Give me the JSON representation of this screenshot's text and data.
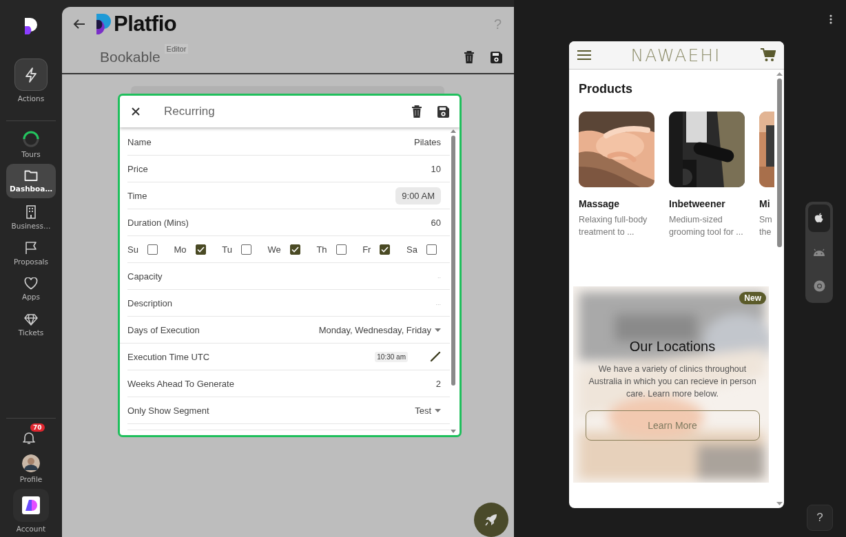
{
  "sidebar": {
    "actions": {
      "label": "Actions"
    },
    "items": [
      {
        "label": "Tours",
        "selected": false
      },
      {
        "label": "Dashboa…",
        "selected": true
      },
      {
        "label": "Business…",
        "selected": false
      },
      {
        "label": "Proposals",
        "selected": false
      },
      {
        "label": "Apps",
        "selected": false
      },
      {
        "label": "Tickets",
        "selected": false
      }
    ],
    "notifications": {
      "badge": "70"
    },
    "profile": {
      "label": "Profile"
    },
    "account": {
      "label": "Account"
    }
  },
  "header": {
    "logo_text": "Platfio",
    "help": "?",
    "title": "Bookable",
    "tag": "Editor"
  },
  "modal": {
    "title": "Recurring",
    "rows": [
      {
        "kind": "text",
        "label": "Name",
        "value": "Pilates"
      },
      {
        "kind": "text",
        "label": "Price",
        "value": "10"
      },
      {
        "kind": "chip",
        "label": "Time",
        "value": "9:00 AM"
      },
      {
        "kind": "text",
        "label": "Duration (Mins)",
        "value": "60"
      },
      {
        "kind": "days",
        "days": [
          {
            "label": "Su",
            "checked": false
          },
          {
            "label": "Mo",
            "checked": true
          },
          {
            "label": "Tu",
            "checked": false
          },
          {
            "label": "We",
            "checked": true
          },
          {
            "label": "Th",
            "checked": false
          },
          {
            "label": "Fr",
            "checked": true
          },
          {
            "label": "Sa",
            "checked": false
          }
        ]
      },
      {
        "kind": "hint",
        "label": "Capacity",
        "placeholder": ".."
      },
      {
        "kind": "hint",
        "label": "Description",
        "placeholder": "..."
      },
      {
        "kind": "select",
        "label": "Days of Execution",
        "value": "Monday, Wednesday, Friday"
      },
      {
        "kind": "edit",
        "label": "Execution Time UTC",
        "value": "10:30 am"
      },
      {
        "kind": "text",
        "label": "Weeks Ahead To Generate",
        "value": "2"
      },
      {
        "kind": "select",
        "label": "Only Show Segment",
        "value": "Test"
      }
    ]
  },
  "preview": {
    "brand": "NAWAEHI",
    "products_title": "Products",
    "products": [
      {
        "kind": "full",
        "name": "Massage",
        "description": "Relaxing full-body treatment to ..."
      },
      {
        "kind": "full",
        "name": "Inbetweener",
        "description": "Medium-sized grooming tool for ..."
      },
      {
        "kind": "partial",
        "name": "Mi",
        "description": "Sm the"
      }
    ],
    "promo": {
      "badge": "New",
      "title": "Our Locations",
      "text": "We have a variety of clinics throughout Australia in which you can recieve in person care. Learn more below.",
      "button": "Learn More"
    }
  },
  "platforms": [
    {
      "selected": true
    },
    {
      "selected": false
    },
    {
      "selected": false
    }
  ],
  "help": "?"
}
